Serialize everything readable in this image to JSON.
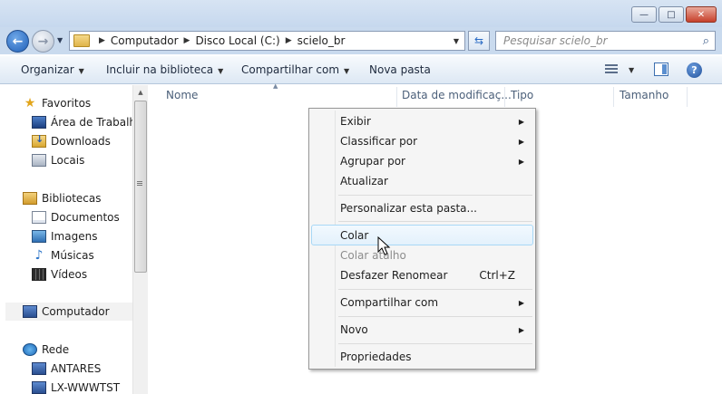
{
  "window": {
    "minimize_glyph": "—",
    "maximize_glyph": "□",
    "close_glyph": "✕"
  },
  "nav": {
    "back_glyph": "←",
    "forward_glyph": "→",
    "recent_glyph": "▼",
    "address": {
      "crumbs": [
        "Computador",
        "Disco Local (C:)",
        "scielo_br"
      ],
      "separator": "▶",
      "dropdown_glyph": "▼"
    },
    "refresh_glyph": "⇆",
    "search": {
      "placeholder": "Pesquisar scielo_br",
      "icon_glyph": "⌕"
    }
  },
  "toolbar": {
    "items": [
      {
        "label": "Organizar",
        "has_caret": true
      },
      {
        "label": "Incluir na biblioteca",
        "has_caret": true
      },
      {
        "label": "Compartilhar com",
        "has_caret": true
      },
      {
        "label": "Nova pasta",
        "has_caret": false
      }
    ],
    "caret_glyph": "▼",
    "help_glyph": "?"
  },
  "sidebar": {
    "items": [
      {
        "label": "Favoritos",
        "icon": "star-icon"
      },
      {
        "label": "Área de Trabalho",
        "icon": "desktop-icon"
      },
      {
        "label": "Downloads",
        "icon": "downloads-icon"
      },
      {
        "label": "Locais",
        "icon": "recent-places-icon"
      },
      {
        "label": "Bibliotecas",
        "icon": "libraries-icon"
      },
      {
        "label": "Documentos",
        "icon": "documents-icon"
      },
      {
        "label": "Imagens",
        "icon": "pictures-icon"
      },
      {
        "label": "Músicas",
        "icon": "music-icon"
      },
      {
        "label": "Vídeos",
        "icon": "videos-icon"
      },
      {
        "label": "Computador",
        "icon": "computer-icon",
        "selected": true
      },
      {
        "label": "Rede",
        "icon": "network-icon"
      },
      {
        "label": "ANTARES",
        "icon": "network-host-icon"
      },
      {
        "label": "LX-WWWTST",
        "icon": "network-host-icon"
      }
    ],
    "star_glyph": "★",
    "music_glyph": "♪",
    "scroll_up_glyph": "▲"
  },
  "columns": [
    "Nome",
    "Data de modificaç...",
    "Tipo",
    "Tamanho"
  ],
  "sort_glyph": "▲",
  "context_menu": {
    "items": [
      {
        "label": "Exibir",
        "submenu": true
      },
      {
        "label": "Classificar por",
        "submenu": true
      },
      {
        "label": "Agrupar por",
        "submenu": true
      },
      {
        "label": "Atualizar"
      },
      {
        "label": "Personalizar esta pasta..."
      },
      {
        "label": "Colar",
        "highlighted": true
      },
      {
        "label": "Colar atalho",
        "disabled": true
      },
      {
        "label": "Desfazer Renomear",
        "shortcut": "Ctrl+Z"
      },
      {
        "label": "Compartilhar com",
        "submenu": true
      },
      {
        "label": "Novo",
        "submenu": true
      },
      {
        "label": "Propriedades"
      }
    ],
    "submenu_glyph": "▶"
  }
}
